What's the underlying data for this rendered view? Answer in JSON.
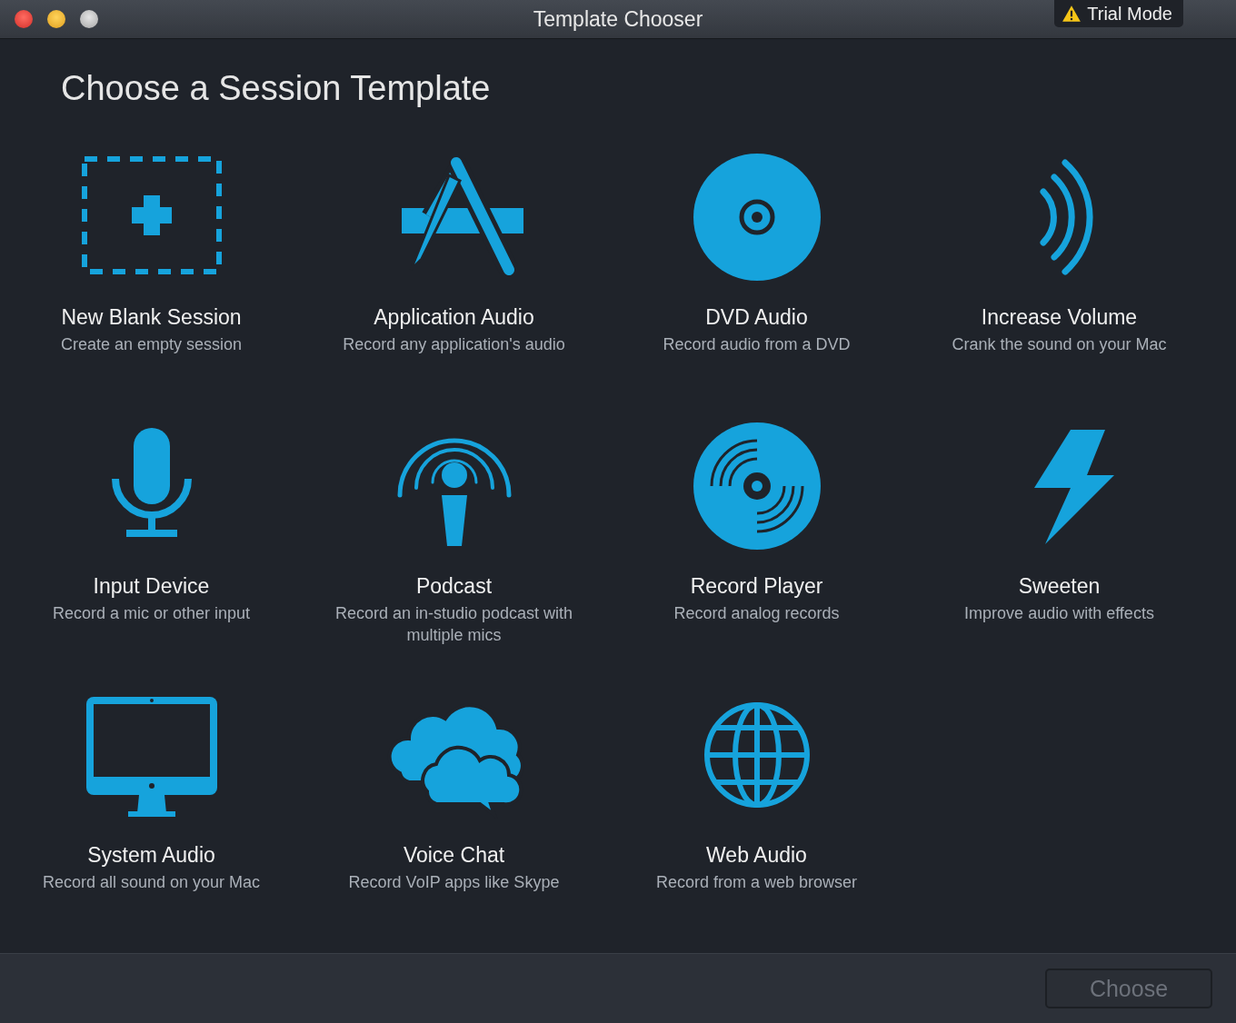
{
  "window": {
    "title": "Template Chooser",
    "badge": "Trial Mode"
  },
  "heading": "Choose a Session Template",
  "templates": [
    {
      "kind": "blank",
      "title": "New Blank Session",
      "subtitle": "Create an empty session"
    },
    {
      "kind": "app",
      "title": "Application Audio",
      "subtitle": "Record any application's audio"
    },
    {
      "kind": "dvd",
      "title": "DVD Audio",
      "subtitle": "Record audio from a DVD"
    },
    {
      "kind": "volume",
      "title": "Increase Volume",
      "subtitle": "Crank the sound on your Mac"
    },
    {
      "kind": "mic",
      "title": "Input Device",
      "subtitle": "Record a mic or other input"
    },
    {
      "kind": "podcast",
      "title": "Podcast",
      "subtitle": "Record an in-studio podcast with multiple mics"
    },
    {
      "kind": "record",
      "title": "Record Player",
      "subtitle": "Record analog records"
    },
    {
      "kind": "bolt",
      "title": "Sweeten",
      "subtitle": "Improve audio with effects"
    },
    {
      "kind": "monitor",
      "title": "System Audio",
      "subtitle": "Record all sound on your Mac"
    },
    {
      "kind": "cloud",
      "title": "Voice Chat",
      "subtitle": "Record VoIP apps like Skype"
    },
    {
      "kind": "globe",
      "title": "Web Audio",
      "subtitle": "Record from a web browser"
    }
  ],
  "choose_button": {
    "label": "Choose",
    "disabled": true
  }
}
